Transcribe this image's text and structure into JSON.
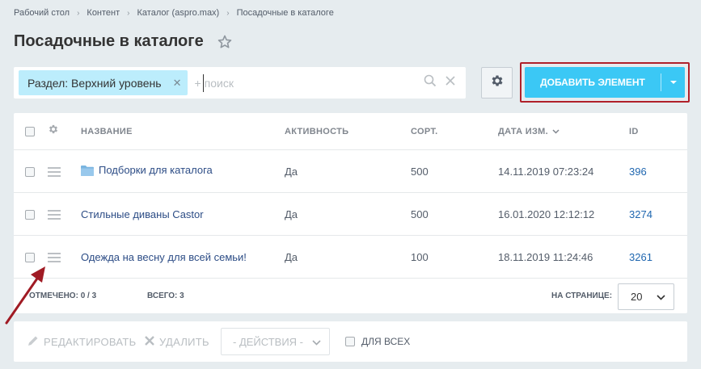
{
  "breadcrumb": [
    "Рабочий стол",
    "Контент",
    "Каталог (aspro.max)",
    "Посадочные в каталоге"
  ],
  "page_title": "Посадочные в каталоге",
  "filter": {
    "tag_label": "Раздел: Верхний уровень",
    "plus": "+",
    "search_placeholder": "поиск"
  },
  "add_button": {
    "label": "ДОБАВИТЬ ЭЛЕМЕНТ"
  },
  "columns": {
    "name": "НАЗВАНИЕ",
    "active": "АКТИВНОСТЬ",
    "sort": "СОРТ.",
    "date": "ДАТА ИЗМ.",
    "id": "ID"
  },
  "rows": [
    {
      "name": "Подборки для каталога",
      "active": "Да",
      "sort": "500",
      "date": "14.11.2019 07:23:24",
      "id": "396"
    },
    {
      "name": "Стильные диваны Castor",
      "active": "Да",
      "sort": "500",
      "date": "16.01.2020 12:12:12",
      "id": "3274"
    },
    {
      "name": "Одежда на весну для всей семьи!",
      "active": "Да",
      "sort": "100",
      "date": "18.11.2019 11:24:46",
      "id": "3261"
    }
  ],
  "footer": {
    "marked_label": "ОТМЕЧЕНО:",
    "marked_value": "0 / 3",
    "total_label": "ВСЕГО:",
    "total_value": "3",
    "per_page_label": "НА СТРАНИЦЕ:",
    "per_page_value": "20"
  },
  "actions": {
    "edit": "РЕДАКТИРОВАТЬ",
    "delete": "УДАЛИТЬ",
    "select": "- ДЕЙСТВИЯ -",
    "for_all": "ДЛЯ ВСЕХ"
  },
  "colors": {
    "accent": "#3bc8f5",
    "highlight_border": "#b0202a",
    "arrow": "#a01b24"
  }
}
